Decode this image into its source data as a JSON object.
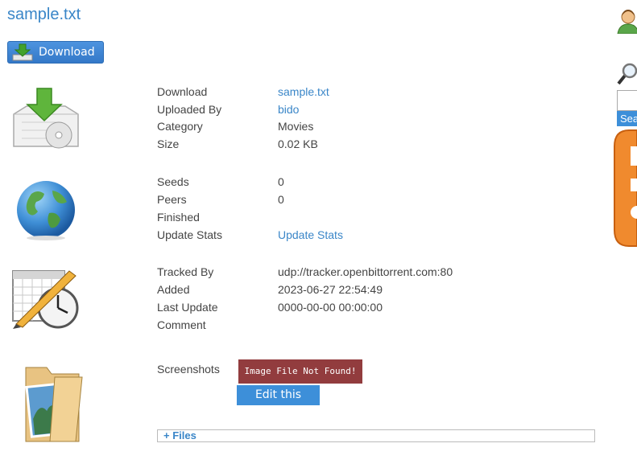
{
  "header": {
    "title": "sample.txt",
    "download_button": "Download"
  },
  "details": {
    "download_label": "Download",
    "download_value": "sample.txt",
    "uploaded_by_label": "Uploaded By",
    "uploaded_by_value": "bido",
    "category_label": "Category",
    "category_value": "Movies",
    "size_label": "Size",
    "size_value": "0.02 KB",
    "seeds_label": "Seeds",
    "seeds_value": "0",
    "peers_label": "Peers",
    "peers_value": "0",
    "finished_label": "Finished",
    "finished_value": "",
    "update_stats_label": "Update Stats",
    "update_stats_link": "Update Stats",
    "tracked_by_label": "Tracked By",
    "tracked_by_value": "udp://tracker.openbittorrent.com:80",
    "added_label": "Added",
    "added_value": "2023-06-27 22:54:49",
    "last_update_label": "Last Update",
    "last_update_value": "0000-00-00 00:00:00",
    "comment_label": "Comment",
    "comment_value": "",
    "screenshots_label": "Screenshots",
    "screenshot_placeholder": "Image File Not Found!",
    "edit_button": "Edit this torrent",
    "files_toggle": "+ Files"
  },
  "sidebar": {
    "search_button": "Sea"
  },
  "icons": {
    "download": "download-box-icon",
    "globe": "globe-icon",
    "calendar": "calendar-clock-icon",
    "folder": "picture-folder-icon",
    "user": "user-icon",
    "search": "magnifier-icon"
  }
}
